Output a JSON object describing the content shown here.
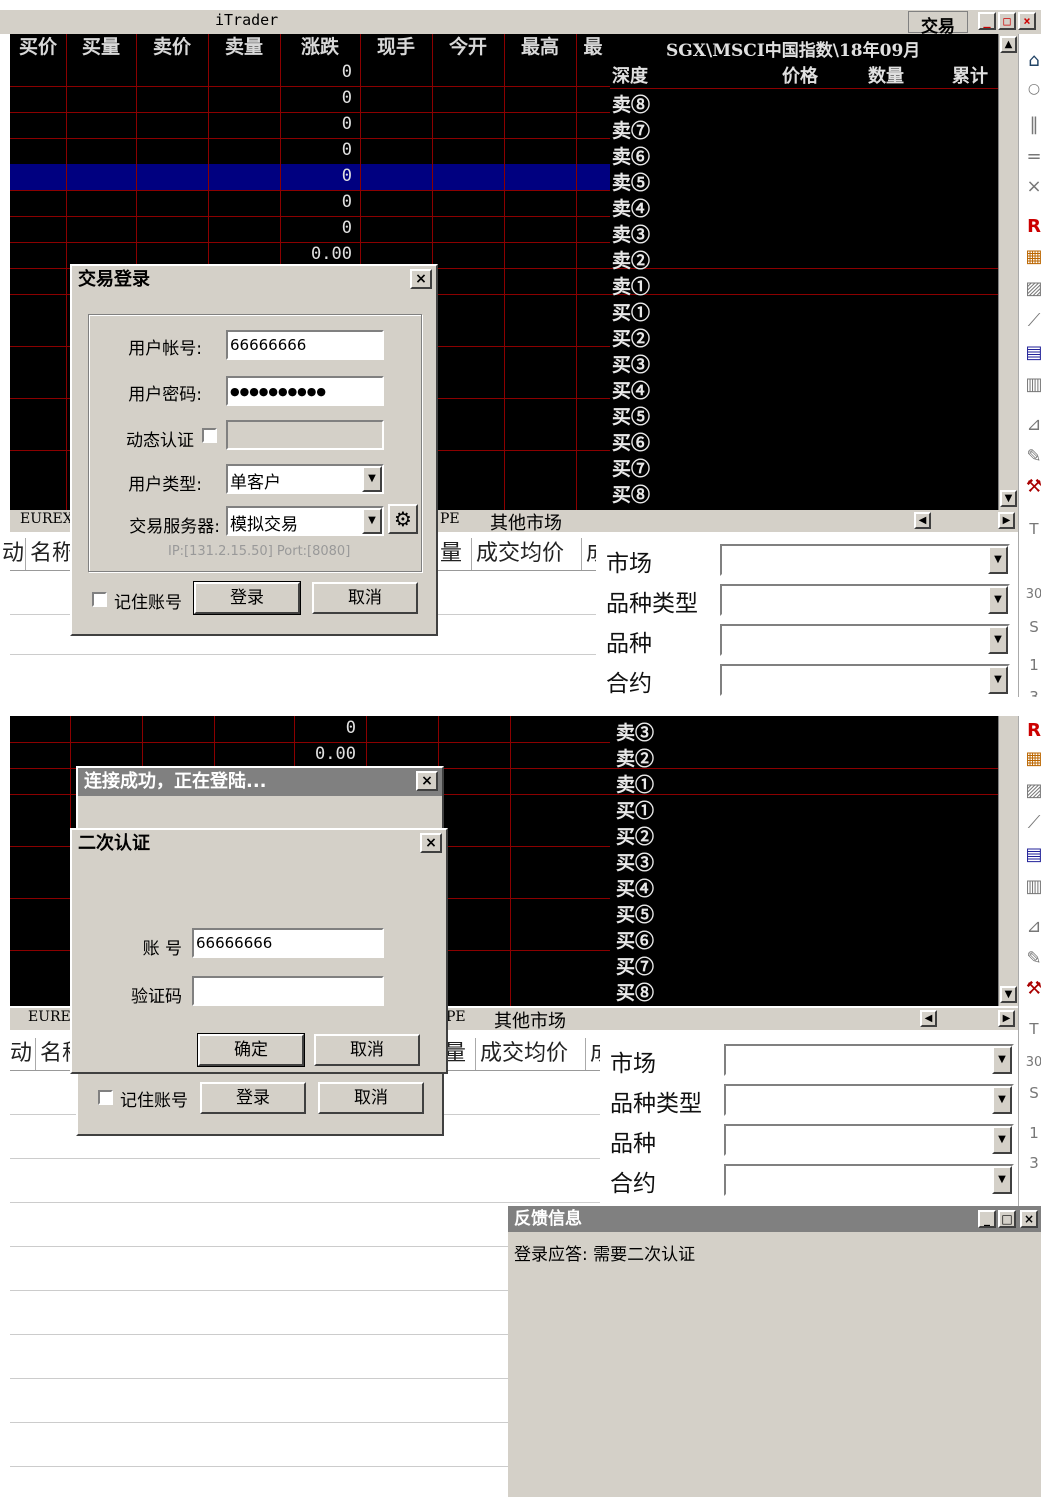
{
  "app": {
    "title": "iTrader",
    "trade_button": "交易"
  },
  "quote_table": {
    "columns": [
      "买价",
      "买量",
      "卖价",
      "卖量",
      "涨跌",
      "现手",
      "今开",
      "最高",
      "最"
    ],
    "change_values": [
      "0",
      "0",
      "0",
      "0",
      "0",
      "0",
      "0",
      "0.00"
    ],
    "change_values_panel2": [
      "0",
      "0.00"
    ]
  },
  "depth_panel": {
    "instrument": "SGX\\MSCI中国指数\\18年09月",
    "headers": [
      "深度",
      "价格",
      "数量",
      "累计"
    ],
    "levels": [
      "卖⑧",
      "卖⑦",
      "卖⑥",
      "卖⑤",
      "卖④",
      "卖③",
      "卖②",
      "卖①",
      "买①",
      "买②",
      "买③",
      "买④",
      "买⑤",
      "买⑥",
      "买⑦",
      "买⑧"
    ],
    "levels_panel2": [
      "卖③",
      "卖②",
      "卖①",
      "买①",
      "买②",
      "买③",
      "买④",
      "买⑤",
      "买⑥",
      "买⑦",
      "买⑧"
    ]
  },
  "market_tabs": {
    "left": "EUREX",
    "left_panel2": "EURE",
    "mid": "PE",
    "other": "其他市场"
  },
  "lower_table": {
    "headers": [
      "动",
      "名称",
      "量",
      "成交均价",
      "成"
    ]
  },
  "filter": {
    "labels": [
      "市场",
      "品种类型",
      "品种",
      "合约"
    ]
  },
  "login_dialog": {
    "title": "交易登录",
    "account_label": "用户帐号:",
    "account_value": "66666666",
    "password_label": "用户密码:",
    "password_value": "●●●●●●●●●●",
    "dynamic_auth_label": "动态认证",
    "user_type_label": "用户类型:",
    "user_type_value": "单客户",
    "server_label": "交易服务器:",
    "server_value": "模拟交易",
    "server_info": "IP:[131.2.15.50]   Port:[8080]",
    "remember_label": "记住账号",
    "login_button": "登录",
    "cancel_button": "取消"
  },
  "connecting_dialog": {
    "title": "连接成功，正在登陆..."
  },
  "second_auth_dialog": {
    "title": "二次认证",
    "account_label": "账  号",
    "account_value": "66666666",
    "code_label": "验证码",
    "code_value": "",
    "ok_button": "确定",
    "cancel_button": "取消"
  },
  "feedback": {
    "title": "反馈信息",
    "message": "登录应答: 需要二次认证"
  },
  "right_toolbar": {
    "tab_letters": [
      "T",
      "30",
      "S",
      "1",
      "3"
    ]
  }
}
